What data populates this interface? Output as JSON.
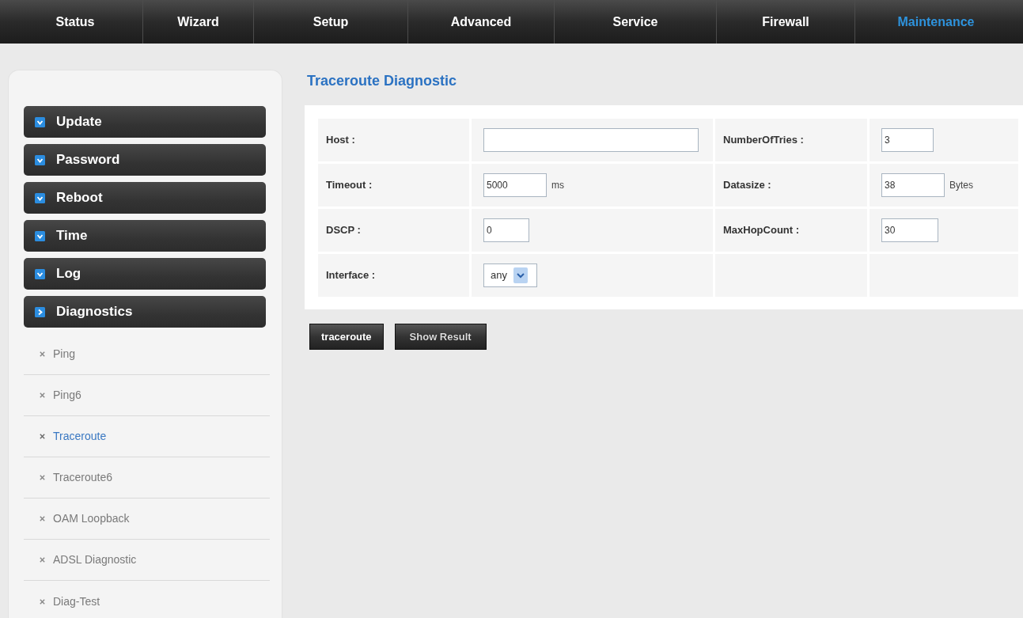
{
  "nav": {
    "tabs": [
      {
        "label": "Status",
        "selected": false
      },
      {
        "label": "Wizard",
        "selected": false
      },
      {
        "label": "Setup",
        "selected": false
      },
      {
        "label": "Advanced",
        "selected": false
      },
      {
        "label": "Service",
        "selected": false
      },
      {
        "label": "Firewall",
        "selected": false
      },
      {
        "label": "Maintenance",
        "selected": true
      }
    ]
  },
  "sidebar": {
    "menu": [
      {
        "label": "Update",
        "expanded": false
      },
      {
        "label": "Password",
        "expanded": false
      },
      {
        "label": "Reboot",
        "expanded": false
      },
      {
        "label": "Time",
        "expanded": false
      },
      {
        "label": "Log",
        "expanded": false
      },
      {
        "label": "Diagnostics",
        "expanded": true,
        "children": [
          {
            "label": "Ping",
            "selected": false
          },
          {
            "label": "Ping6",
            "selected": false
          },
          {
            "label": "Traceroute",
            "selected": true
          },
          {
            "label": "Traceroute6",
            "selected": false
          },
          {
            "label": "OAM Loopback",
            "selected": false
          },
          {
            "label": "ADSL Diagnostic",
            "selected": false
          },
          {
            "label": "Diag-Test",
            "selected": false
          }
        ]
      }
    ]
  },
  "main": {
    "title": "Traceroute Diagnostic",
    "rows": [
      [
        {
          "label": "Host :",
          "kind": "text"
        },
        {
          "label": "NumberOfTries :",
          "kind": "text",
          "value": "3"
        }
      ],
      [
        {
          "label": "Timeout :",
          "kind": "text",
          "value": "5000",
          "unit": "ms"
        },
        {
          "label": "Datasize :",
          "kind": "text",
          "value": "38",
          "unit": "Bytes"
        }
      ],
      [
        {
          "label": "DSCP :",
          "kind": "text",
          "value": "0"
        },
        {
          "label": "MaxHopCount :",
          "kind": "text",
          "value": "30"
        }
      ],
      [
        {
          "label": "Interface :",
          "kind": "select",
          "value": "any"
        }
      ]
    ],
    "buttons": [
      "traceroute",
      "Show Result"
    ]
  }
}
